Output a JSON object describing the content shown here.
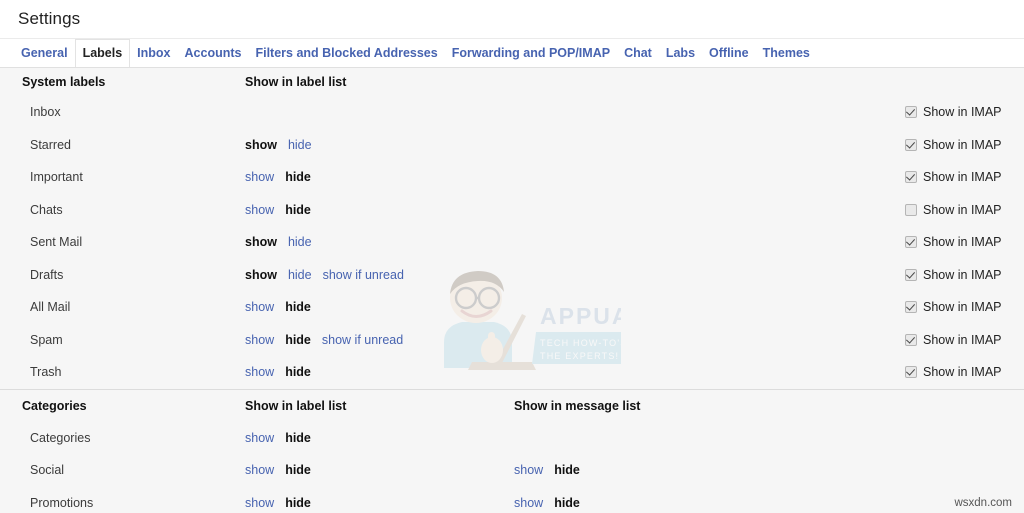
{
  "window": {
    "page_title": "Settings",
    "watermark_text": "APPUALS",
    "watermark_tagline_1": "TECH HOW-TO'S FROM",
    "watermark_tagline_2": "THE EXPERTS!",
    "site_mark": "wsxdn.com"
  },
  "tabs": [
    {
      "label": "General",
      "active": false
    },
    {
      "label": "Labels",
      "active": true
    },
    {
      "label": "Inbox",
      "active": false
    },
    {
      "label": "Accounts",
      "active": false
    },
    {
      "label": "Filters and Blocked Addresses",
      "active": false
    },
    {
      "label": "Forwarding and POP/IMAP",
      "active": false
    },
    {
      "label": "Chat",
      "active": false
    },
    {
      "label": "Labs",
      "active": false
    },
    {
      "label": "Offline",
      "active": false
    },
    {
      "label": "Themes",
      "active": false
    }
  ],
  "colors": {
    "link": "#4763b0",
    "active_text": "#111111",
    "content_bg": "#f6f6f6",
    "tab_active_bg": "#ffffff"
  },
  "columns": {
    "name_header": "System labels",
    "label_list_header": "Show in label list",
    "message_list_header": "Show in message list",
    "imap_label": "Show in IMAP"
  },
  "options": {
    "show": "show",
    "hide": "hide",
    "show_if_unread": "show if unread"
  },
  "system_labels": {
    "section_title": "System labels",
    "label_list_header": "Show in label list",
    "rows": [
      {
        "name": "Inbox",
        "label_list": [],
        "imap": {
          "label": "Show in IMAP",
          "checked": true
        }
      },
      {
        "name": "Starred",
        "label_list": [
          {
            "text": "show",
            "active": true
          },
          {
            "text": "hide",
            "active": false
          }
        ],
        "imap": {
          "label": "Show in IMAP",
          "checked": true
        }
      },
      {
        "name": "Important",
        "label_list": [
          {
            "text": "show",
            "active": false
          },
          {
            "text": "hide",
            "active": true
          }
        ],
        "imap": {
          "label": "Show in IMAP",
          "checked": true
        }
      },
      {
        "name": "Chats",
        "label_list": [
          {
            "text": "show",
            "active": false
          },
          {
            "text": "hide",
            "active": true
          }
        ],
        "imap": {
          "label": "Show in IMAP",
          "checked": false
        }
      },
      {
        "name": "Sent Mail",
        "label_list": [
          {
            "text": "show",
            "active": true
          },
          {
            "text": "hide",
            "active": false
          }
        ],
        "imap": {
          "label": "Show in IMAP",
          "checked": true
        }
      },
      {
        "name": "Drafts",
        "label_list": [
          {
            "text": "show",
            "active": true
          },
          {
            "text": "hide",
            "active": false
          },
          {
            "text": "show if unread",
            "active": false
          }
        ],
        "imap": {
          "label": "Show in IMAP",
          "checked": true
        }
      },
      {
        "name": "All Mail",
        "label_list": [
          {
            "text": "show",
            "active": false
          },
          {
            "text": "hide",
            "active": true
          }
        ],
        "imap": {
          "label": "Show in IMAP",
          "checked": true
        }
      },
      {
        "name": "Spam",
        "label_list": [
          {
            "text": "show",
            "active": false
          },
          {
            "text": "hide",
            "active": true
          },
          {
            "text": "show if unread",
            "active": false
          }
        ],
        "imap": {
          "label": "Show in IMAP",
          "checked": true
        }
      },
      {
        "name": "Trash",
        "label_list": [
          {
            "text": "show",
            "active": false
          },
          {
            "text": "hide",
            "active": true
          }
        ],
        "imap": {
          "label": "Show in IMAP",
          "checked": true
        }
      }
    ]
  },
  "categories": {
    "section_title": "Categories",
    "label_list_header": "Show in label list",
    "message_list_header": "Show in message list",
    "rows": [
      {
        "name": "Categories",
        "label_list": [
          {
            "text": "show",
            "active": false
          },
          {
            "text": "hide",
            "active": true
          }
        ],
        "message_list": []
      },
      {
        "name": "Social",
        "label_list": [
          {
            "text": "show",
            "active": false
          },
          {
            "text": "hide",
            "active": true
          }
        ],
        "message_list": [
          {
            "text": "show",
            "active": false
          },
          {
            "text": "hide",
            "active": true
          }
        ]
      },
      {
        "name": "Promotions",
        "label_list": [
          {
            "text": "show",
            "active": false
          },
          {
            "text": "hide",
            "active": true
          }
        ],
        "message_list": [
          {
            "text": "show",
            "active": false
          },
          {
            "text": "hide",
            "active": true
          }
        ]
      }
    ]
  }
}
